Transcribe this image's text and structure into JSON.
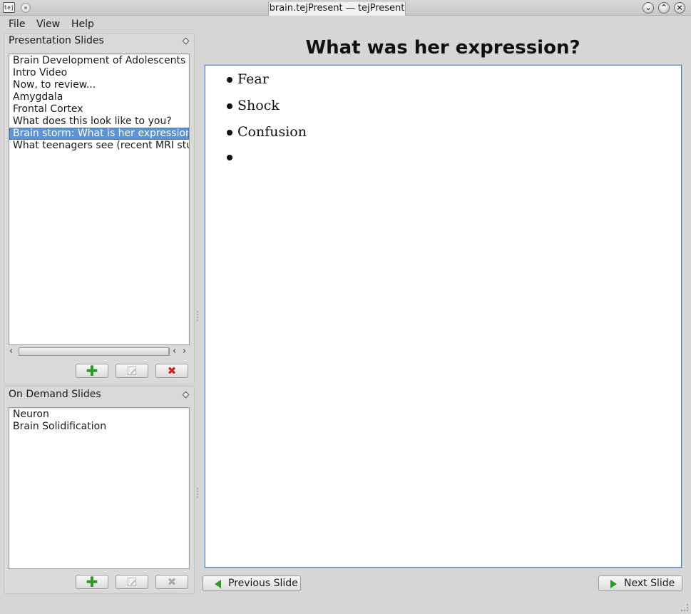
{
  "window": {
    "title": "brain.tejPresent — tejPresent",
    "app_icon_text": "tej"
  },
  "menu": [
    "File",
    "View",
    "Help"
  ],
  "presentation_pane": {
    "title": "Presentation Slides",
    "items": [
      "Brain Development of Adolescents",
      "Intro Video",
      "Now, to review...",
      "Amygdala",
      "Frontal Cortex",
      "What does this look like to you?",
      "Brain storm: What is her expression?",
      "What teenagers see (recent MRI studies)"
    ],
    "selected_index": 6
  },
  "on_demand_pane": {
    "title": "On Demand Slides",
    "items": [
      "Neuron",
      "Brain Solidification"
    ]
  },
  "slide": {
    "title": "What was her expression?",
    "bullets": [
      "Fear",
      "Shock",
      "Confusion",
      ""
    ]
  },
  "navigation": {
    "previous_label": "Previous Slide",
    "next_label": "Next Slide"
  },
  "colors": {
    "selection": "#5d94d6",
    "add_icon": "#2a9a1e",
    "delete_icon": "#d0211d",
    "nav_arrow": "#23a11a",
    "slide_border": "#4a88d8"
  }
}
